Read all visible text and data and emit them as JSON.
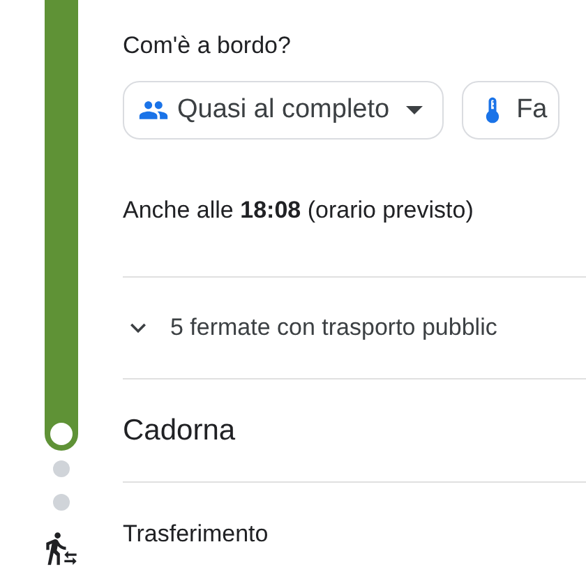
{
  "question": "Com'è a bordo?",
  "chips": [
    {
      "kind": "crowding",
      "label": "Quasi al completo"
    },
    {
      "kind": "temperature",
      "label": "Fa"
    }
  ],
  "also_at": "Anche alle **18:08** (orario previsto)",
  "stops_toggle": {
    "label": "5 fermate con trasporto pubblic",
    "expanded": false
  },
  "stop": {
    "name": "Cadorna"
  },
  "transfer": {
    "label": "Trasferimento"
  }
}
